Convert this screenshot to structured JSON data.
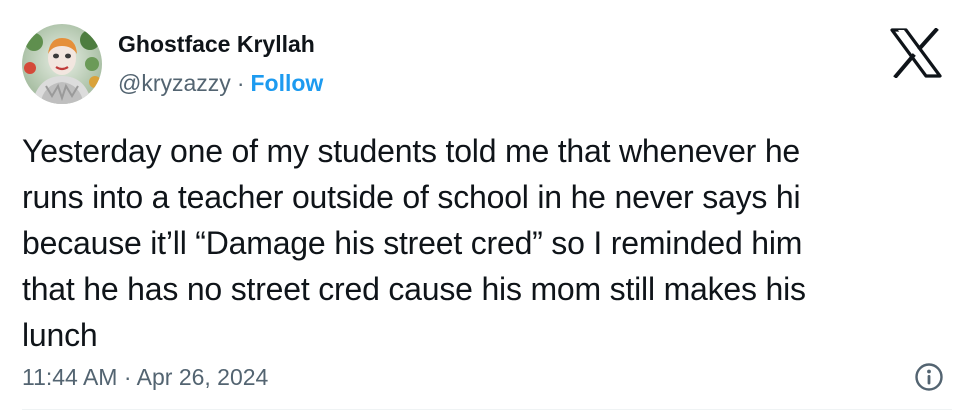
{
  "author": {
    "display_name": "Ghostface Kryllah",
    "handle": "@kryzazzy",
    "separator": "·",
    "follow_label": "Follow",
    "avatar_icon": "profile-avatar"
  },
  "brand": {
    "logo_icon": "x-logo-icon"
  },
  "tweet": {
    "lines": [
      "Yesterday one of my students told me that whenever he",
      "runs into a teacher outside of school in he never says hi",
      "because it’ll “Damage his street cred” so I reminded him",
      "that he has no street cred cause his mom still makes his",
      "lunch"
    ],
    "timestamp": "11:44 AM · Apr 26, 2024"
  },
  "colors": {
    "text": "#0f1419",
    "secondary": "#536471",
    "accent": "#1d9bf0",
    "divider": "#eff3f4"
  }
}
